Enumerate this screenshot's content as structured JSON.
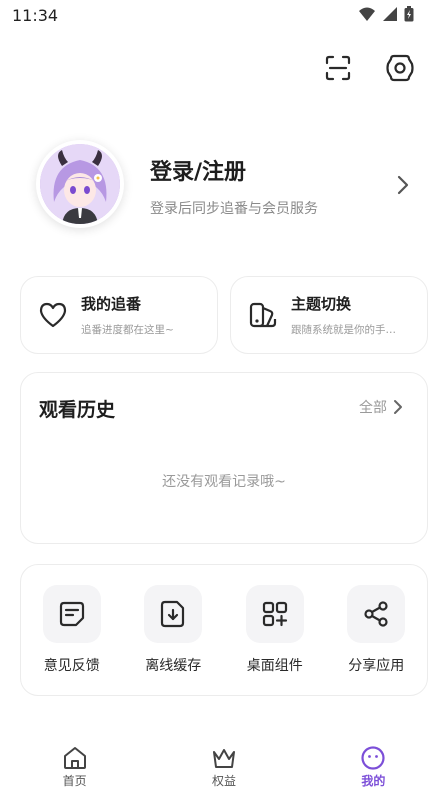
{
  "status_bar": {
    "time": "11:34"
  },
  "header": {
    "scan_icon": "scan-icon",
    "settings_icon": "settings-icon"
  },
  "profile": {
    "title": "登录/注册",
    "subtitle": "登录后同步追番与会员服务",
    "avatar": "anime-girl-avatar"
  },
  "cards": [
    {
      "title": "我的追番",
      "subtitle": "追番进度都在这里~",
      "icon": "heart-icon"
    },
    {
      "title": "主题切换",
      "subtitle": "跟随系统就是你的手…",
      "icon": "theme-icon"
    }
  ],
  "history": {
    "title": "观看历史",
    "all_label": "全部",
    "empty_text": "还没有观看记录哦~"
  },
  "tools": [
    {
      "label": "意见反馈",
      "icon": "feedback-icon"
    },
    {
      "label": "离线缓存",
      "icon": "download-icon"
    },
    {
      "label": "桌面组件",
      "icon": "widget-icon"
    },
    {
      "label": "分享应用",
      "icon": "share-icon"
    }
  ],
  "tabbar": [
    {
      "label": "首页",
      "icon": "home-icon",
      "active": false
    },
    {
      "label": "权益",
      "icon": "crown-icon",
      "active": false
    },
    {
      "label": "我的",
      "icon": "smile-icon",
      "active": true
    }
  ],
  "colors": {
    "accent": "#7c4fd8",
    "muted": "#9a9a9a",
    "border": "#ececec"
  }
}
